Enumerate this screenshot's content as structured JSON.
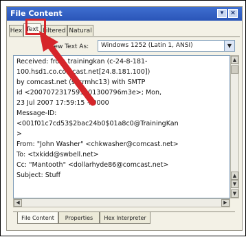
{
  "window": {
    "title": "File Content",
    "minimize_glyph": "▾",
    "close_glyph": "×"
  },
  "tabs": [
    {
      "label": "Hex"
    },
    {
      "label": "Text",
      "active": true
    },
    {
      "label": "Filtered"
    },
    {
      "label": "Natural"
    }
  ],
  "view_as": {
    "label": "View Text As:",
    "value": "Windows 1252 (Latin 1, ANSI)"
  },
  "content_lines": [
    "Received: from trainingkan (c-24-8-181-",
    "100.hsd1.co.comcast.net[24.8.181.100])",
    "        by comcast.net (sccrmhc13) with SMTP",
    "        id <2007072317591501300796m3e>; Mon,",
    "23 Jul 2007 17:59:15 +0000",
    "Message-ID:",
    "<001f01c7cd53$2bac24b0$01a8c0@TrainingKan",
    ">",
    "From: \"John Washer\" <chkwasher@comcast.net>",
    "To: <txkidd@swbell.net>",
    "Cc: \"Mantooth\" <dollarhyde86@comcast.net>",
    "Subject: Stuff"
  ],
  "bottom_tabs": [
    {
      "label": "File Content",
      "active": true
    },
    {
      "label": "Properties"
    },
    {
      "label": "Hex Interpreter"
    }
  ],
  "colors": {
    "highlight": "#d6252a",
    "arrow": "#d6252a",
    "titlebar": "#2a55b8"
  },
  "icons": [
    "scroll-up-icon",
    "scroll-down-icon",
    "scroll-left-icon",
    "scroll-right-icon"
  ]
}
